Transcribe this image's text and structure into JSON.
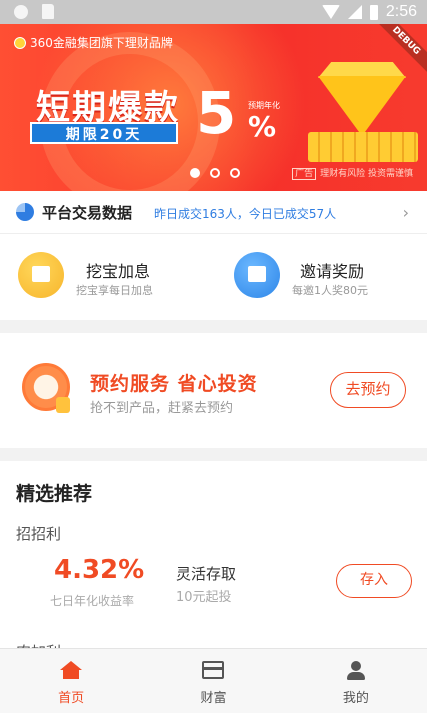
{
  "status_bar": {
    "time": "2:56",
    "icons": [
      "circle-icon",
      "sd-card-icon",
      "wifi-icon",
      "signal-icon",
      "battery-icon"
    ]
  },
  "banner": {
    "top_text": "360金融集团旗下理财品牌",
    "title": "短期爆款",
    "tag": "期限20天",
    "rate_number": "5",
    "rate_symbol": "%",
    "rate_label": "预期年化",
    "ad_label": "广告",
    "ad_notice": "理财有风险 投资需谨慎",
    "debug_label": "DEBUG",
    "dots_count": 3,
    "active_dot": 0
  },
  "stats": {
    "title": "平台交易数据",
    "text": "昨日成交163人，今日已成交57人",
    "arrow": "›"
  },
  "quick_entries": [
    {
      "title": "挖宝加息",
      "subtitle": "挖宝享每日加息",
      "icon": "treasure-chest-icon",
      "color": "#f7b52c"
    },
    {
      "title": "邀请奖励",
      "subtitle": "每邀1人奖80元",
      "icon": "chart-card-icon",
      "color": "#2e86e8"
    }
  ],
  "reservation": {
    "title": "预约服务 省心投资",
    "subtitle": "抢不到产品，赶紧去预约",
    "button": "去预约",
    "icon": "alarm-clock-icon"
  },
  "recommend": {
    "title": "精选推荐",
    "products": [
      {
        "name": "招招利",
        "rate": "4.32%",
        "rate_label": "七日年化收益率",
        "type": "灵活存取",
        "min": "10元起投",
        "button": "存入"
      },
      {
        "name": "农加利"
      }
    ]
  },
  "bottom_nav": {
    "items": [
      {
        "label": "首页",
        "icon": "home-icon",
        "active": true
      },
      {
        "label": "财富",
        "icon": "wallet-icon",
        "active": false
      },
      {
        "label": "我的",
        "icon": "user-icon",
        "active": false
      }
    ]
  },
  "colors": {
    "accent": "#f04b24",
    "link_blue": "#2f7de1",
    "banner_red": "#f6302a"
  }
}
